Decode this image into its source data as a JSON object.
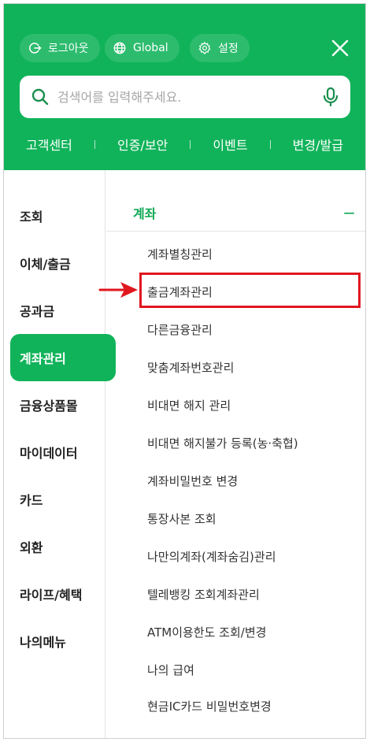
{
  "header": {
    "pills": [
      {
        "label": "로그아웃",
        "icon": "logout-icon"
      },
      {
        "label": "Global",
        "icon": "globe-icon"
      },
      {
        "label": "설정",
        "icon": "gear-icon"
      }
    ],
    "close_icon": "close-icon",
    "search": {
      "placeholder": "검색어를 입력해주세요.",
      "value": "",
      "icon": "search-icon",
      "mic_icon": "microphone-icon"
    },
    "quick_links": [
      "고객센터",
      "인증/보안",
      "이벤트",
      "변경/발급"
    ]
  },
  "left_menu": {
    "items": [
      "조회",
      "이체/출금",
      "공과금",
      "계좌관리",
      "금융상품몰",
      "마이데이터",
      "카드",
      "외환",
      "라이프/혜택",
      "나의메뉴"
    ],
    "active": "계좌관리"
  },
  "right_panel": {
    "section_title": "계좌",
    "section_toggle": "−",
    "items": [
      "계좌별칭관리",
      "출금계좌관리",
      "다른금융관리",
      "맞춤계좌번호관리",
      "비대면 해지 관리",
      "비대면 해지불가 등록(농·축협)",
      "계좌비밀번호 변경",
      "통장사본 조회",
      "나만의계좌(계좌숨김)관리",
      "텔레뱅킹 조회계좌관리",
      "ATM이용한도 조회/변경",
      "나의 급여",
      "현금IC카드 비밀번호변경"
    ],
    "highlighted": "출금계좌관리"
  },
  "colors": {
    "brand": "#11b35a",
    "highlight_border": "#e0171f",
    "arrow": "#e0171f"
  }
}
